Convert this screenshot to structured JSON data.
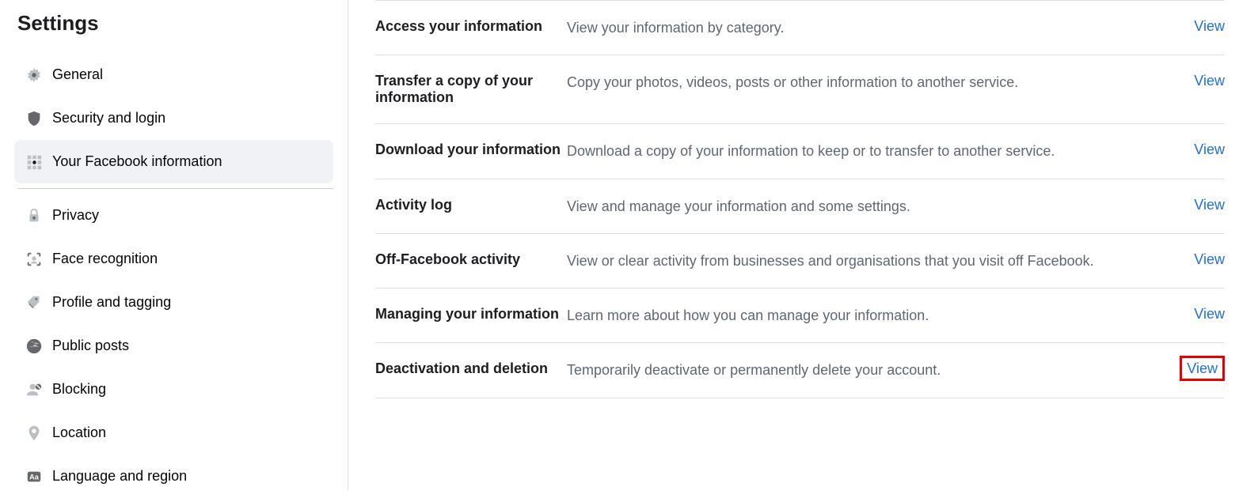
{
  "sidebar": {
    "title": "Settings",
    "items": [
      {
        "label": "General",
        "icon": "gear-icon"
      },
      {
        "label": "Security and login",
        "icon": "shield-icon"
      },
      {
        "label": "Your Facebook information",
        "icon": "grid-icon",
        "active": true
      },
      {
        "label": "Privacy",
        "icon": "lock-icon"
      },
      {
        "label": "Face recognition",
        "icon": "face-icon"
      },
      {
        "label": "Profile and tagging",
        "icon": "tag-icon"
      },
      {
        "label": "Public posts",
        "icon": "globe-icon"
      },
      {
        "label": "Blocking",
        "icon": "blocking-icon"
      },
      {
        "label": "Location",
        "icon": "location-icon"
      },
      {
        "label": "Language and region",
        "icon": "language-icon"
      }
    ]
  },
  "main": {
    "rows": [
      {
        "title": "Access your information",
        "desc": "View your information by category.",
        "action": "View"
      },
      {
        "title": "Transfer a copy of your information",
        "desc": "Copy your photos, videos, posts or other information to another service.",
        "action": "View"
      },
      {
        "title": "Download your information",
        "desc": "Download a copy of your information to keep or to transfer to another service.",
        "action": "View"
      },
      {
        "title": "Activity log",
        "desc": "View and manage your information and some settings.",
        "action": "View"
      },
      {
        "title": "Off-Facebook activity",
        "desc": "View or clear activity from businesses and organisations that you visit off Facebook.",
        "action": "View"
      },
      {
        "title": "Managing your information",
        "desc": "Learn more about how you can manage your information.",
        "action": "View"
      },
      {
        "title": "Deactivation and deletion",
        "desc": "Temporarily deactivate or permanently delete your account.",
        "action": "View",
        "highlighted": true
      }
    ]
  }
}
